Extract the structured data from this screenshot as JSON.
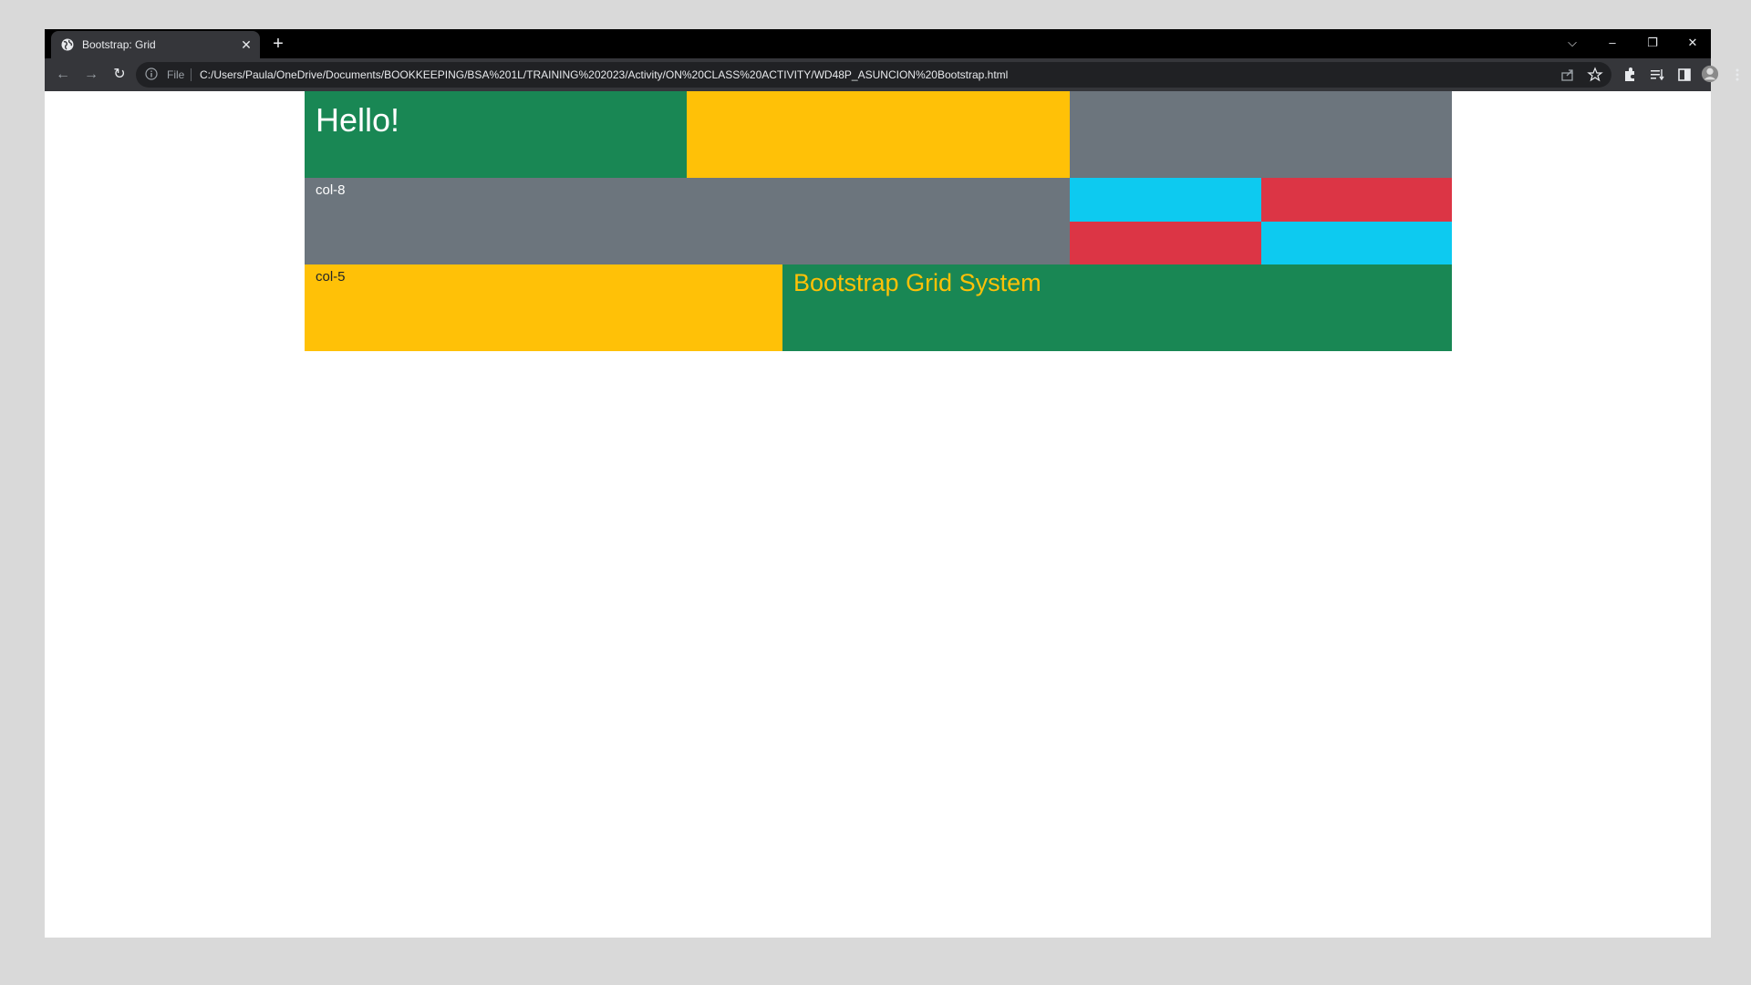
{
  "browser": {
    "tab_title": "Bootstrap: Grid",
    "tab_close": "✕",
    "new_tab": "+",
    "window_controls": {
      "tab_search": "⌵",
      "minimize": "–",
      "restore": "❐",
      "close": "✕"
    },
    "nav": {
      "back": "←",
      "forward": "→",
      "reload": "↻"
    },
    "omnibox": {
      "scheme_label": "File",
      "url": "C:/Users/Paula/OneDrive/Documents/BOOKKEEPING/BSA%201L/TRAINING%202023/Activity/ON%20CLASS%20ACTIVITY/WD48P_ASUNCION%20Bootstrap.html"
    },
    "toolbar_icons": [
      "share-icon",
      "star-icon",
      "extensions-icon",
      "reading-list-icon",
      "side-panel-icon",
      "profile-avatar",
      "menu-icon"
    ]
  },
  "page": {
    "row1": {
      "heading": "Hello!"
    },
    "row2": {
      "label": "col-8"
    },
    "row3": {
      "label": "col-5",
      "heading": "Bootstrap Grid System"
    }
  },
  "colors": {
    "success": "#198754",
    "warning": "#ffc107",
    "secondary": "#6c757d",
    "info": "#0dcaf0",
    "danger": "#dc3545"
  }
}
